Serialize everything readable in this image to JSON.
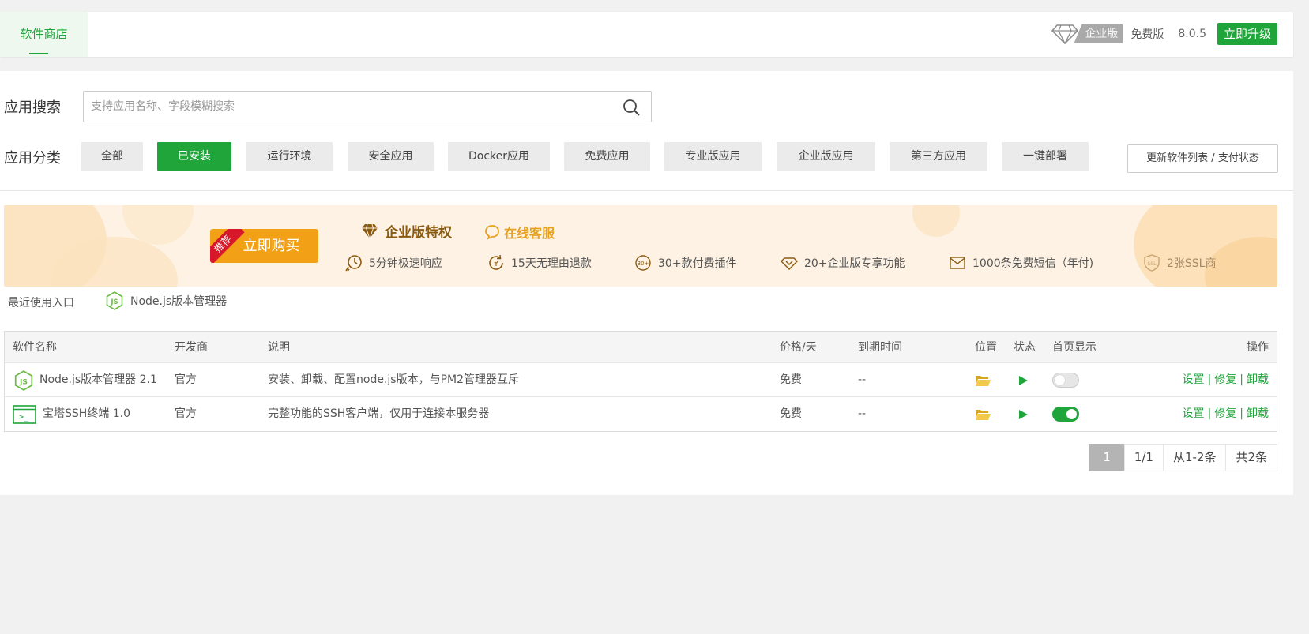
{
  "topbar": {
    "tab_store": "软件商店",
    "enterprise_badge": "企业版",
    "free_label": "免费版",
    "version": "8.0.5",
    "upgrade_button": "立即升级"
  },
  "search": {
    "label": "应用搜索",
    "placeholder": "支持应用名称、字段模糊搜索",
    "value": ""
  },
  "categories": {
    "label": "应用分类",
    "items": [
      "全部",
      "已安装",
      "运行环境",
      "安全应用",
      "Docker应用",
      "免费应用",
      "专业版应用",
      "企业版应用",
      "第三方应用",
      "一键部署"
    ],
    "active": "已安装",
    "refresh_button": "更新软件列表 / 支付状态"
  },
  "banner": {
    "ribbon": "推荐",
    "buy_button": "立即购买",
    "privilege_title": "企业版特权",
    "service": "在线客服",
    "features": [
      "5分钟极速响应",
      "15天无理由退款",
      "30+款付费插件",
      "20+企业版专享功能",
      "1000条免费短信（年付)",
      "2张SSL商"
    ],
    "icon_30": "30+",
    "icon_ssl": "SSL",
    "icon_yen": "¥"
  },
  "recent": {
    "label": "最近使用入口",
    "item": "Node.js版本管理器",
    "js_glyph": "JS"
  },
  "table": {
    "headers": {
      "name": "软件名称",
      "developer": "开发商",
      "description": "说明",
      "price": "价格/天",
      "expire": "到期时间",
      "location": "位置",
      "status": "状态",
      "homepage": "首页显示",
      "actions": "操作"
    },
    "rows": [
      {
        "name": "Node.js版本管理器 2.1",
        "developer": "官方",
        "description": "安装、卸载、配置node.js版本，与PM2管理器互斥",
        "price": "免费",
        "expire": "--",
        "homepage_on": false,
        "icon": "nodejs-icon"
      },
      {
        "name": "宝塔SSH终端 1.0",
        "developer": "官方",
        "description": "完整功能的SSH客户端，仅用于连接本服务器",
        "price": "免费",
        "expire": "--",
        "homepage_on": true,
        "icon": "terminal-icon"
      }
    ],
    "actions": {
      "settings": "设置",
      "repair": "修复",
      "uninstall": "卸载",
      "sep": "|"
    },
    "terminal_glyph": ">_"
  },
  "pagination": {
    "current": "1",
    "pages": "1/1",
    "range": "从1-2条",
    "total": "共2条"
  },
  "colors": {
    "accent": "#20a53a",
    "banner_bg": "#fdf2e3",
    "buy_button": "#f2a117",
    "ribbon": "#d7172a",
    "privilege_title": "#8a5a10",
    "service": "#e8a020",
    "enterprise_badge": "#a9a9a9"
  }
}
